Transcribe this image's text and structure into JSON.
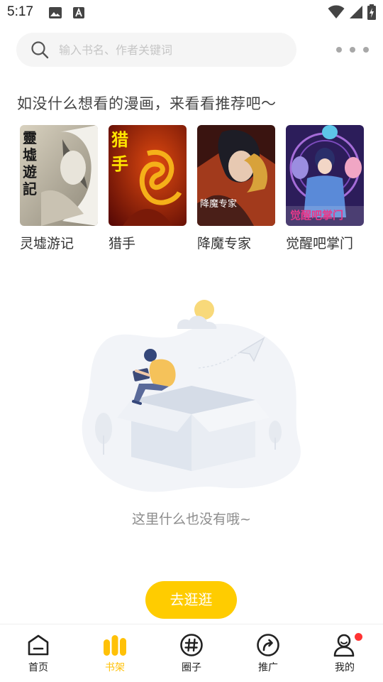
{
  "status_bar": {
    "time": "5:17"
  },
  "search": {
    "placeholder": "输入书名、作者关键词"
  },
  "recommend": {
    "title": "如没什么想看的漫画，来看看推荐吧～",
    "items": [
      {
        "name": "灵墟游记",
        "cover_text": "靈墟遊記"
      },
      {
        "name": "猎手",
        "cover_text": "猎手"
      },
      {
        "name": "降魔专家",
        "cover_text": "降魔专家"
      },
      {
        "name": "觉醒吧掌门",
        "cover_text": "觉醒吧掌门"
      }
    ]
  },
  "empty_state": {
    "message": "这里什么也没有哦~",
    "button_label": "去逛逛"
  },
  "tab_bar": {
    "tabs": [
      {
        "label": "首页",
        "icon": "home-icon",
        "active": false
      },
      {
        "label": "书架",
        "icon": "bookshelf-icon",
        "active": true
      },
      {
        "label": "圈子",
        "icon": "hashtag-icon",
        "active": false
      },
      {
        "label": "推广",
        "icon": "share-icon",
        "active": false
      },
      {
        "label": "我的",
        "icon": "profile-icon",
        "active": false,
        "badge": true
      }
    ]
  },
  "colors": {
    "accent": "#ffcc00",
    "active_tab": "#ffc107",
    "badge": "#ff3333"
  }
}
